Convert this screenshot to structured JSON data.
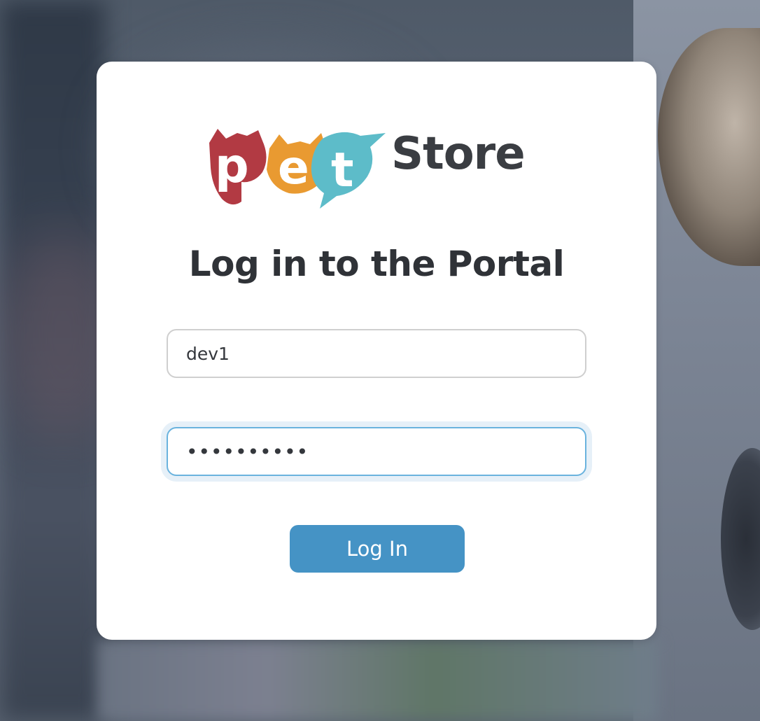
{
  "brand": {
    "logo_text": "PetStore",
    "logo_letters": [
      "p",
      "e",
      "t"
    ],
    "wordmark": "Store",
    "colors": {
      "p": "#b23a43",
      "e": "#e99a31",
      "t": "#5dbcc9",
      "wordmark": "#3a3d42"
    }
  },
  "login": {
    "title": "Log in to the Portal",
    "username_value": "dev1",
    "password_value": "••••••••••",
    "submit_label": "Log In"
  },
  "theme": {
    "card_background": "#ffffff",
    "button_color": "#4593c5",
    "focus_border": "#6ab3de"
  }
}
